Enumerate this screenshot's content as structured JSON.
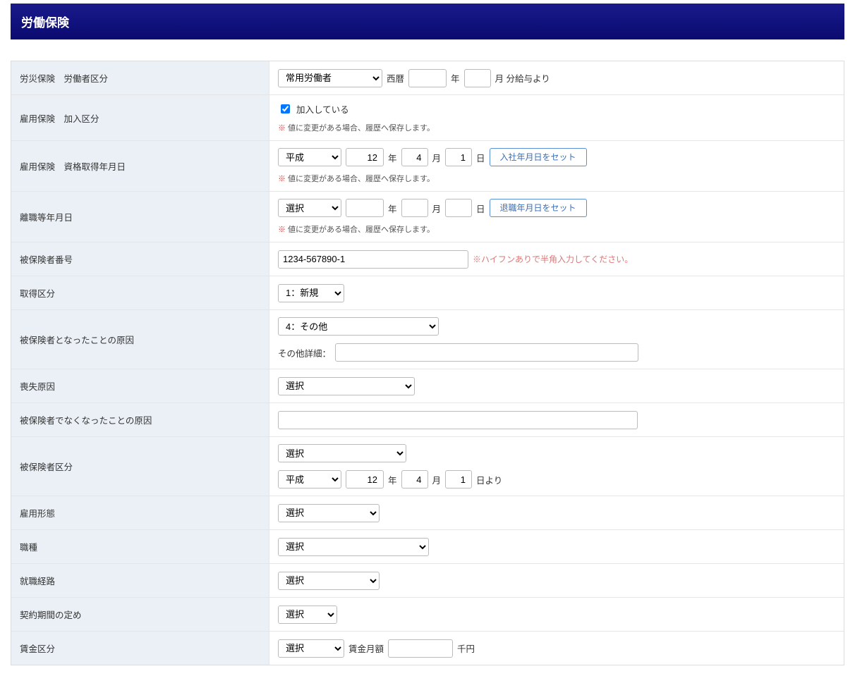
{
  "header": {
    "title": "労働保険"
  },
  "rows": {
    "r1": {
      "label": "労災保険　労働者区分",
      "select": "常用労働者",
      "seireki": "西暦",
      "year_suffix": "年",
      "month_suffix": "月 分給与より"
    },
    "r2": {
      "label": "雇用保険　加入区分",
      "checkbox_label": "加入している",
      "note_prefix": "※",
      "note": " 値に変更がある場合、履歴へ保存します。"
    },
    "r3": {
      "label": "雇用保険　資格取得年月日",
      "era": "平成",
      "year": "12",
      "year_suffix": "年",
      "month": "4",
      "month_suffix": "月",
      "day": "1",
      "day_suffix": "日",
      "button": "入社年月日をセット",
      "note_prefix": "※",
      "note": " 値に変更がある場合、履歴へ保存します。"
    },
    "r4": {
      "label": "離職等年月日",
      "era": "選択",
      "year_suffix": "年",
      "month_suffix": "月",
      "day_suffix": "日",
      "button": "退職年月日をセット",
      "note_prefix": "※",
      "note": " 値に変更がある場合、履歴へ保存します。"
    },
    "r5": {
      "label": "被保険者番号",
      "value": "1234-567890-1",
      "hint_prefix": "※",
      "hint": "ハイフンありで半角入力してください。"
    },
    "r6": {
      "label": "取得区分",
      "select": "1：新規"
    },
    "r7": {
      "label": "被保険者となったことの原因",
      "select": "4：その他",
      "detail_label": "その他詳細："
    },
    "r8": {
      "label": "喪失原因",
      "select": "選択"
    },
    "r9": {
      "label": "被保険者でなくなったことの原因"
    },
    "r10": {
      "label": "被保険者区分",
      "select": "選択",
      "era": "平成",
      "year": "12",
      "year_suffix": "年",
      "month": "4",
      "month_suffix": "月",
      "day": "1",
      "day_suffix": "日より"
    },
    "r11": {
      "label": "雇用形態",
      "select": "選択"
    },
    "r12": {
      "label": "職種",
      "select": "選択"
    },
    "r13": {
      "label": "就職経路",
      "select": "選択"
    },
    "r14": {
      "label": "契約期間の定め",
      "select": "選択"
    },
    "r15": {
      "label": "賃金区分",
      "select": "選択",
      "wage_label": "賃金月額",
      "unit": "千円"
    }
  }
}
